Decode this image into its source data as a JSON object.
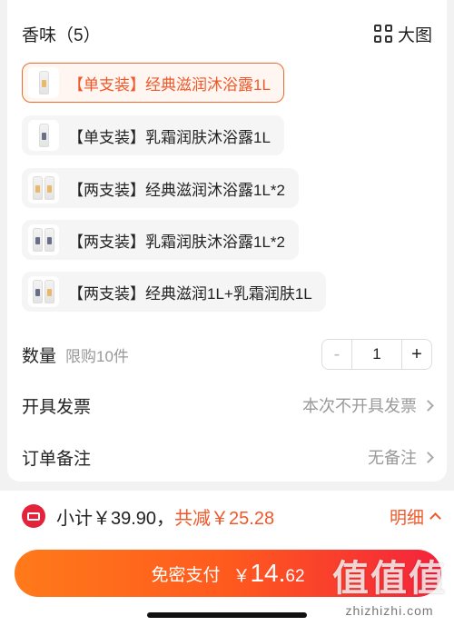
{
  "section": {
    "title": "香味（5）",
    "big_view_label": "大图"
  },
  "options": [
    {
      "label": "【单支装】经典滋润沐浴露1L",
      "selected": true
    },
    {
      "label": "【单支装】乳霜润肤沐浴露1L",
      "selected": false
    },
    {
      "label": "【两支装】经典滋润沐浴露1L*2",
      "selected": false
    },
    {
      "label": "【两支装】乳霜润肤沐浴露1L*2",
      "selected": false
    },
    {
      "label": "【两支装】经典滋润1L+乳霜润肤1L",
      "selected": false
    }
  ],
  "quantity": {
    "label": "数量",
    "limit": "限购10件",
    "minus": "-",
    "value": "1",
    "plus": "+"
  },
  "invoice": {
    "label": "开具发票",
    "value": "本次不开具发票"
  },
  "remark": {
    "label": "订单备注",
    "value": "无备注"
  },
  "summary": {
    "subtotal": "小计￥39.90，",
    "discount": "共减￥25.28",
    "detail": "明细"
  },
  "pay": {
    "label": "免密支付",
    "currency": "￥",
    "amount_int": "14.",
    "amount_dec": "62"
  },
  "watermark": {
    "glyphs": "值值值",
    "text": "zhizhizhi.com"
  },
  "colors": {
    "accent": "#f0582a",
    "selected_bg": "#fff6f1",
    "pay_start": "#ff7a1a",
    "pay_end": "#f4233c"
  }
}
